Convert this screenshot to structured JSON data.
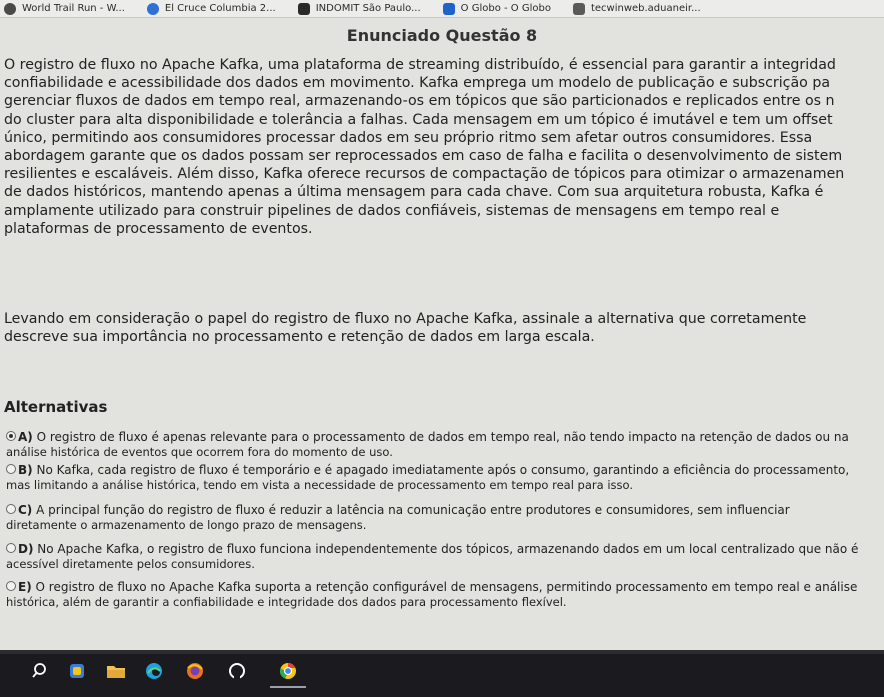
{
  "bookmarks": [
    {
      "label": "World Trail Run - W...",
      "icon": "globe-icon",
      "color": "#4a4a4a"
    },
    {
      "label": "El Cruce Columbia 2...",
      "icon": "site-icon",
      "color": "#2f6fd6"
    },
    {
      "label": "INDOMIT São Paulo...",
      "icon": "site-icon",
      "color": "#2a2a2a"
    },
    {
      "label": "O Globo - O Globo",
      "icon": "globo-icon",
      "color": "#1e64c8"
    },
    {
      "label": "tecwinweb.aduaneir...",
      "icon": "site-icon",
      "color": "#5a5a5a"
    }
  ],
  "question": {
    "title": "Enunciado Questão 8",
    "paragraph1": [
      "O registro de fluxo no Apache Kafka, uma plataforma de streaming distribuído, é essencial para garantir a integridad",
      "confiabilidade e acessibilidade dos dados em movimento. Kafka emprega um modelo de publicação e subscrição pa",
      "gerenciar fluxos de dados em tempo real, armazenando-os em tópicos que são particionados e replicados entre os n",
      "do cluster para alta disponibilidade e tolerância a falhas. Cada mensagem em um tópico é imutável e tem um offset",
      "único, permitindo aos consumidores processar dados em seu próprio ritmo sem afetar outros consumidores. Essa",
      "abordagem garante que os dados possam ser reprocessados em caso de falha e facilita o desenvolvimento de sistem",
      "resilientes e escaláveis. Além disso, Kafka oferece recursos de compactação de tópicos para otimizar o armazenamen",
      "de dados históricos, mantendo apenas a última mensagem para cada chave. Com sua arquitetura robusta, Kafka é",
      "amplamente utilizado para construir pipelines de dados confiáveis, sistemas de mensagens em tempo real e",
      "plataformas de processamento de eventos."
    ],
    "paragraph2": [
      "Levando em consideração o papel do registro de fluxo no Apache Kafka, assinale a alternativa  que corretamente",
      "descreve sua importância no processamento e retenção de dados em larga escala."
    ]
  },
  "alternatives_title": "Alternativas",
  "alternatives": [
    {
      "letter": "A)",
      "line1": "O registro de fluxo é apenas relevante para o processamento de dados em tempo real, não tendo impacto na retenção de dados ou na",
      "line2": "análise histórica de eventos que ocorrem fora do momento de uso.",
      "selected": true
    },
    {
      "letter": "B)",
      "line1": "No Kafka, cada registro de fluxo é temporário e é apagado imediatamente após o consumo, garantindo a eficiência do processamento,",
      "line2": "mas limitando a análise histórica, tendo em vista a necessidade de processamento em tempo real para isso.",
      "selected": false
    },
    {
      "letter": "C)",
      "line1": "A principal função do registro de fluxo é reduzir a latência na comunicação entre produtores e consumidores, sem influenciar",
      "line2": "diretamente o armazenamento de longo prazo de mensagens.",
      "selected": false
    },
    {
      "letter": "D)",
      "line1": "No Apache Kafka, o registro de fluxo funciona independentemente dos tópicos, armazenando dados em um local centralizado que não é",
      "line2": "acessível diretamente pelos consumidores.",
      "selected": false
    },
    {
      "letter": "E)",
      "line1": "O registro de fluxo no Apache Kafka suporta a retenção configurável de mensagens, permitindo processamento em tempo real e análise",
      "line2": "histórica, além de garantir a confiabilidade e integridade dos dados para processamento flexível.",
      "selected": false
    }
  ],
  "taskbar": [
    {
      "icon": "search-icon",
      "color": "#ffffff"
    },
    {
      "icon": "widgets-icon",
      "color": "#3a7bd5"
    },
    {
      "icon": "file-explorer-icon",
      "color": "#f2c14e"
    },
    {
      "icon": "edge-icon",
      "color": "#1fa3d9"
    },
    {
      "icon": "firefox-icon",
      "color": "#e8731c"
    },
    {
      "icon": "github-icon",
      "color": "#ffffff"
    },
    {
      "icon": "chrome-icon",
      "color": "#f5c518"
    }
  ]
}
